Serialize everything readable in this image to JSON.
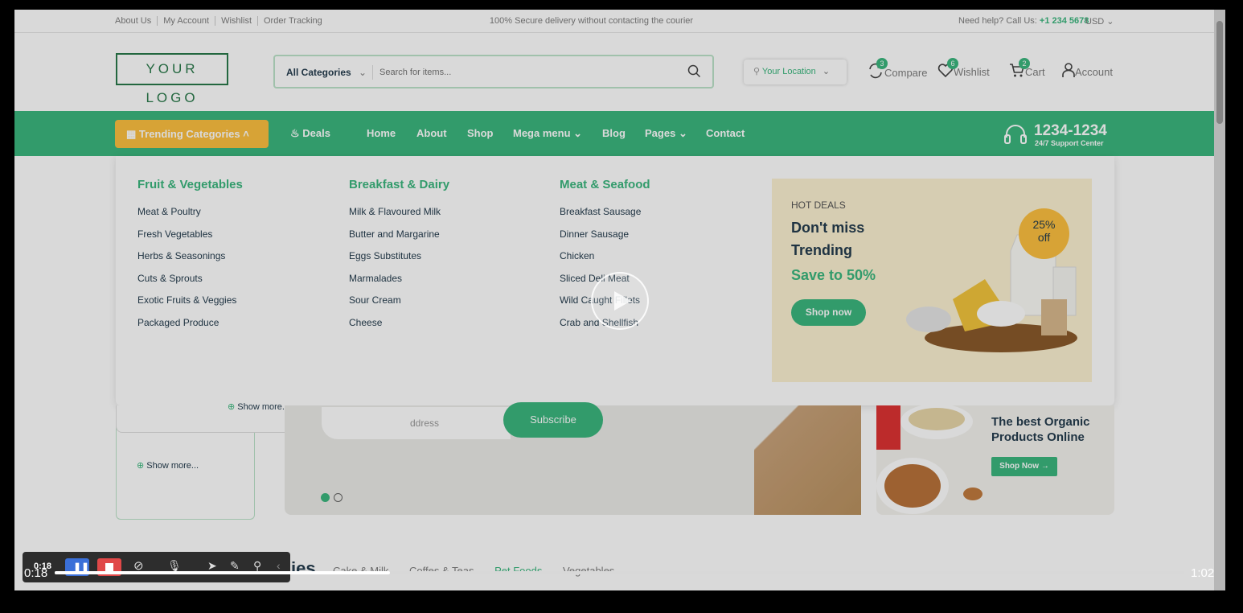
{
  "topbar": {
    "links": [
      "About Us",
      "My Account",
      "Wishlist",
      "Order Tracking"
    ],
    "message": "100% Secure delivery without contacting the courier",
    "help_prefix": "Need help? Call Us: ",
    "help_phone": "+1 234 5678",
    "currency": "USD"
  },
  "header": {
    "logo": "YOUR LOGO",
    "category": "All Categories",
    "search_placeholder": "Search for items...",
    "location": "Your Location",
    "icons": [
      {
        "label": "Compare",
        "count": "3",
        "icon": "compare-icon"
      },
      {
        "label": "Wishlist",
        "count": "6",
        "icon": "heart-icon"
      },
      {
        "label": "Cart",
        "count": "2",
        "icon": "cart-icon"
      },
      {
        "label": "Account",
        "count": "",
        "icon": "user-icon"
      }
    ]
  },
  "nav": {
    "trending": "Trending Categories",
    "deals": "Deals",
    "links": [
      "Home",
      "About",
      "Shop",
      "Mega menu",
      "Blog",
      "Pages",
      "Contact"
    ],
    "phone": "1234-1234",
    "phone_sub": "24/7 Support Center"
  },
  "mega": {
    "columns": [
      {
        "title": "Fruit & Vegetables",
        "items": [
          "Meat & Poultry",
          "Fresh Vegetables",
          "Herbs & Seasonings",
          "Cuts & Sprouts",
          "Exotic Fruits & Veggies",
          "Packaged Produce"
        ]
      },
      {
        "title": "Breakfast & Dairy",
        "items": [
          "Milk & Flavoured Milk",
          "Butter and Margarine",
          "Eggs Substitutes",
          "Marmalades",
          "Sour Cream",
          "Cheese"
        ]
      },
      {
        "title": "Meat & Seafood",
        "items": [
          "Breakfast Sausage",
          "Dinner Sausage",
          "Chicken",
          "Sliced Deli Meat",
          "Wild Caught Fillets",
          "Crab and Shellfish"
        ]
      }
    ],
    "banner": {
      "label": "HOT DEALS",
      "title": "Don't miss Trending",
      "save": "Save to 50%",
      "button": "Shop now",
      "discount_pct": "25%",
      "discount_off": "off"
    }
  },
  "below": {
    "show_more": "Show more...",
    "email_placeholder": "ddress",
    "subscribe": "Subscribe",
    "organic_title": "The best Organic Products Online",
    "organic_button": "Shop Now",
    "section_title": "ies",
    "tabs": [
      "Cake & Milk",
      "Coffes & Teas",
      "Pet Foods",
      "Vegetables"
    ]
  },
  "player": {
    "current": "0:18",
    "total": "1:02",
    "rec_time": "0:18",
    "progress": 0.297
  },
  "colors": {
    "green": "#3bb77e",
    "yellow": "#fdc040",
    "dark": "#253d4e"
  }
}
